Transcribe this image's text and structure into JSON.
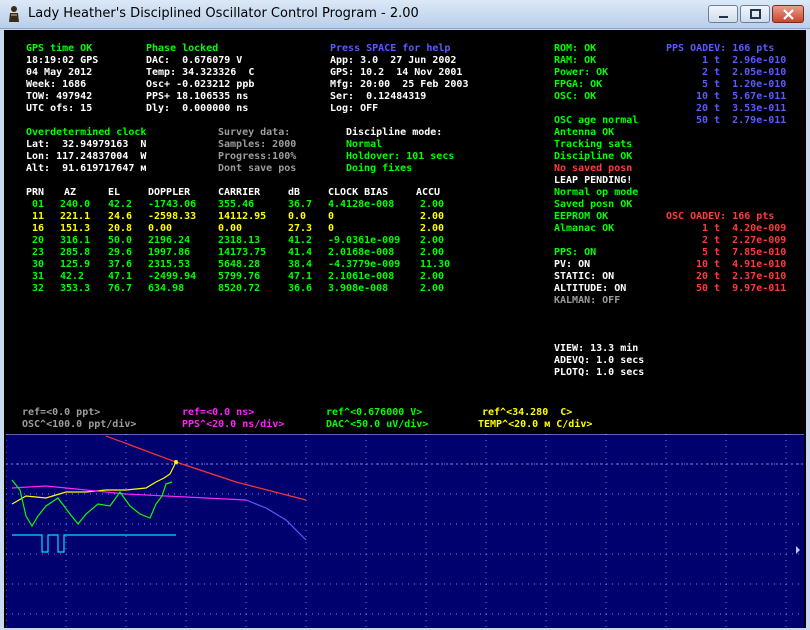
{
  "window": {
    "title": "Lady Heather's Disciplined Oscillator Control Program - 2.00"
  },
  "gps": {
    "status": "GPS time OK",
    "time": "18:19:02 GPS",
    "date": "04 May 2012",
    "week": "Week: 1686",
    "tow": "TOW: 497942",
    "utc": "UTC ofs: 15"
  },
  "phase": {
    "status": "Phase locked",
    "dac": "DAC:  0.676079 V",
    "temp": "Temp: 34.323326  C",
    "osc": "Osc+ -0.023212 ppb",
    "pps": "PPS+ 18.106535 ns",
    "dly": "Dly:  0.000000 ns"
  },
  "help": {
    "press": "Press SPACE for help",
    "app": "App: 3.0  27 Jun 2002",
    "gpsv": "GPS: 10.2  14 Nov 2001",
    "mfg": "Mfg: 20:00  25 Feb 2003",
    "ser": "Ser:  0.12484319",
    "log": "Log: OFF"
  },
  "position": {
    "status": "Overdetermined clock",
    "lat": "Lat:  32.94979163  N",
    "lon": "Lon: 117.24837004  W",
    "alt": "Alt:  91.619717647 м"
  },
  "survey": {
    "title": "Survey data:",
    "samples": "Samples: 2000",
    "progress": "Progress:100%",
    "save": "Dont save pos"
  },
  "discipline": {
    "title": "Discipline mode:",
    "mode": "Normal",
    "holdover": "Holdover: 101 secs",
    "fixes": "Doing fixes"
  },
  "sat_headers": [
    "PRN",
    "AZ",
    "EL",
    "DOPPLER",
    "CARRIER",
    "dB",
    "CLOCK BIAS",
    "ACCU"
  ],
  "sats": [
    {
      "prn": "01",
      "az": "240.0",
      "el": "42.2",
      "doppler": "-1743.06",
      "carrier": "355.46",
      "db": "36.7",
      "bias": "4.4128e-008",
      "accu": "2.00",
      "color": "#00ff00"
    },
    {
      "prn": "11",
      "az": "221.1",
      "el": "24.6",
      "doppler": "-2598.33",
      "carrier": "14112.95",
      "db": "0.0",
      "bias": "0",
      "accu": "2.00",
      "color": "#ffff00"
    },
    {
      "prn": "16",
      "az": "151.3",
      "el": "20.8",
      "doppler": "0.00",
      "carrier": "0.00",
      "db": "27.3",
      "bias": "0",
      "accu": "2.00",
      "color": "#ffff00"
    },
    {
      "prn": "20",
      "az": "316.1",
      "el": "50.0",
      "doppler": "2196.24",
      "carrier": "2318.13",
      "db": "41.2",
      "bias": "-9.0361e-009",
      "accu": "2.00",
      "color": "#00ff00"
    },
    {
      "prn": "23",
      "az": "285.8",
      "el": "29.6",
      "doppler": "1997.86",
      "carrier": "14173.75",
      "db": "41.4",
      "bias": "2.0168e-008",
      "accu": "2.00",
      "color": "#00ff00"
    },
    {
      "prn": "30",
      "az": "125.9",
      "el": "37.6",
      "doppler": "2315.53",
      "carrier": "5648.28",
      "db": "38.4",
      "bias": "-4.3779e-009",
      "accu": "11.30",
      "color": "#00ff00"
    },
    {
      "prn": "31",
      "az": "42.2",
      "el": "47.1",
      "doppler": "-2499.94",
      "carrier": "5799.76",
      "db": "47.1",
      "bias": "2.1061e-008",
      "accu": "2.00",
      "color": "#00ff00"
    },
    {
      "prn": "32",
      "az": "353.3",
      "el": "76.7",
      "doppler": "634.98",
      "carrier": "8520.72",
      "db": "36.6",
      "bias": "3.908e-008",
      "accu": "2.00",
      "color": "#00ff00"
    }
  ],
  "receiver_status": {
    "rom": "ROM: OK",
    "ram": "RAM: OK",
    "power": "Power: OK",
    "fpga": "FPGA: OK",
    "osc": "OSC: OK",
    "osc_age": "OSC age normal",
    "antenna": "Antenna OK",
    "tracking": "Tracking sats",
    "discipline": "Discipline OK",
    "saved_posn": "No saved posn",
    "leap": "LEAP PENDING!",
    "op_mode": "Normal op mode",
    "saved_ok": "Saved posn OK",
    "eeprom": "EEPROM OK",
    "almanac": "Almanac OK",
    "pps": "PPS: ON",
    "pv": "PV: ON",
    "static": "STATIC: ON",
    "altitude": "ALTITUDE: ON",
    "kalman": "KALMAN: OFF",
    "view": "VIEW: 13.3 min",
    "adevq": "ADEVQ: 1.0 secs",
    "plotq": "PLOTQ: 1.0 secs"
  },
  "pps_adev": {
    "title": "PPS OADEV: 166 pts",
    "rows": [
      "1 t  2.96e-010",
      "2 t  2.05e-010",
      "5 t  1.20e-010",
      "10 t  5.67e-011",
      "20 t  3.53e-011",
      "50 t  2.79e-011"
    ]
  },
  "osc_adev": {
    "title": "OSC OADEV: 166 pts",
    "rows": [
      "1 t  4.20e-009",
      "2 t  2.27e-009",
      "5 t  7.85e-010",
      "10 t  4.91e-010",
      "20 t  2.37e-010",
      "50 t  9.97e-011"
    ]
  },
  "plot_legend": {
    "osc_ref": "ref=<0.0 ppt>",
    "osc_scale": "OSC^<100.0 ppt/div>",
    "pps_ref": "ref=<0.0 ns>",
    "pps_scale": "PPS^<20.0 ns/div>",
    "dac_ref": "ref^<0.676000 V>",
    "dac_scale": "DAC^<50.0 uV/div>",
    "temp_ref": "ref^<34.280  C>",
    "temp_scale": "TEMP^<20.0 м C/div>"
  },
  "colors": {
    "osc": "#9c9c9c",
    "pps": "#ff22ff",
    "dac": "#00ff00",
    "temp": "#ffff00",
    "plot_bg": "#00006e"
  }
}
